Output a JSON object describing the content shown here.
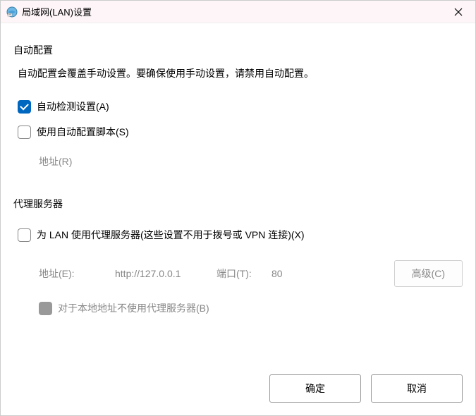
{
  "titlebar": {
    "title": "局域网(LAN)设置"
  },
  "autoConfig": {
    "groupLabel": "自动配置",
    "description": "自动配置会覆盖手动设置。要确保使用手动设置，请禁用自动配置。",
    "autoDetect": {
      "label": "自动检测设置(A)",
      "checked": true
    },
    "useScript": {
      "label": "使用自动配置脚本(S)",
      "checked": false
    },
    "scriptAddress": {
      "label": "地址(R)",
      "value": ""
    }
  },
  "proxy": {
    "groupLabel": "代理服务器",
    "useProxy": {
      "label": "为 LAN 使用代理服务器(这些设置不用于拨号或 VPN 连接)(X)",
      "checked": false
    },
    "address": {
      "label": "地址(E):",
      "value": "http://127.0.0.1"
    },
    "port": {
      "label": "端口(T):",
      "value": "80"
    },
    "advancedButton": "高级(C)",
    "bypassLocal": {
      "label": "对于本地地址不使用代理服务器(B)",
      "checked": true,
      "disabled": true
    }
  },
  "buttons": {
    "ok": "确定",
    "cancel": "取消"
  }
}
